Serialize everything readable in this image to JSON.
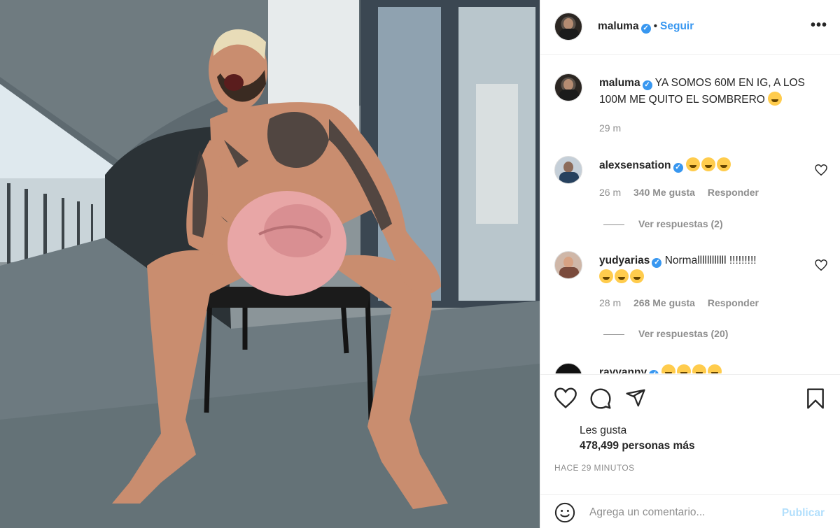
{
  "post": {
    "photo_alt": "",
    "author": "maluma",
    "follow_label": "Seguir",
    "separator": "•",
    "more_label": "•••"
  },
  "comments": [
    {
      "username": "maluma",
      "text": "YA SOMOS 60M EN IG, A LOS 100M ME QUITO EL SOMBRERO",
      "time": "29 m"
    },
    {
      "username": "alexsensation",
      "text": "",
      "time": "26 m",
      "likes": "340 Me gusta",
      "reply": "Responder",
      "view_replies": "Ver respuestas (2)"
    },
    {
      "username": "yudyarias",
      "text": "Normallllllllllll !!!!!!!!!",
      "time": "28 m",
      "likes": "268 Me gusta",
      "reply": "Responder",
      "view_replies": "Ver respuestas (20)"
    },
    {
      "username": "rayvanny",
      "text": ""
    }
  ],
  "likes": {
    "label": "Les gusta",
    "count": "478,499 personas más"
  },
  "timestamp": "HACE 29 MINUTOS",
  "composer": {
    "placeholder": "Agrega un comentario...",
    "publish_label": "Publicar"
  },
  "colors": {
    "link_blue": "#3897f0",
    "publish_disabled": "#b2dffc",
    "muted_text": "#8e8e8e",
    "verified_badge": "#3897f0"
  },
  "icons": [
    "verified-icon",
    "more-icon",
    "heart-icon",
    "comment-icon",
    "share-icon",
    "bookmark-icon",
    "emoji-icon"
  ]
}
